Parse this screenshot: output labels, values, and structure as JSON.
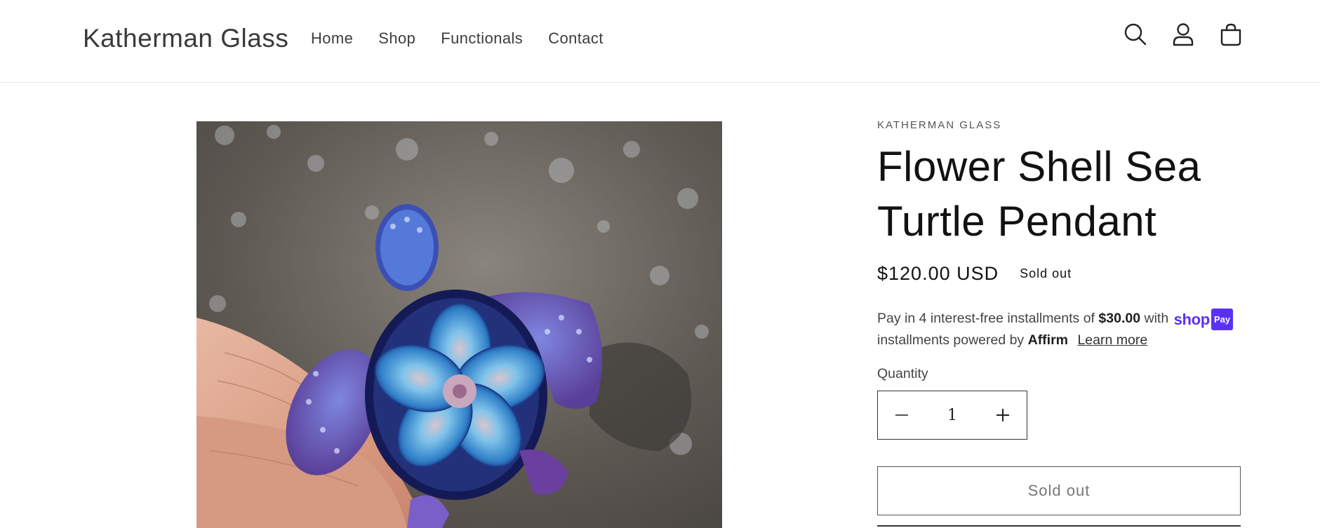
{
  "header": {
    "brand": "Katherman Glass",
    "nav": [
      "Home",
      "Shop",
      "Functionals",
      "Contact"
    ],
    "icons": [
      "search-icon",
      "account-icon",
      "cart-icon"
    ]
  },
  "product": {
    "vendor": "KATHERMAN GLASS",
    "title": "Flower Shell Sea Turtle Pendant",
    "price": "$120.00 USD",
    "badge": "Sold out",
    "installments": {
      "prefix": "Pay in 4 interest-free installments of",
      "amount": "$30.00",
      "with": "with",
      "shoppay_word": "shop",
      "shoppay_pay": "Pay",
      "powered": "installments powered by",
      "affirm": "Affirm",
      "learn_more": "Learn more"
    },
    "quantity_label": "Quantity",
    "quantity_value": "1",
    "sold_out_button": "Sold out"
  },
  "colors": {
    "shoppay": "#5a31f4"
  }
}
